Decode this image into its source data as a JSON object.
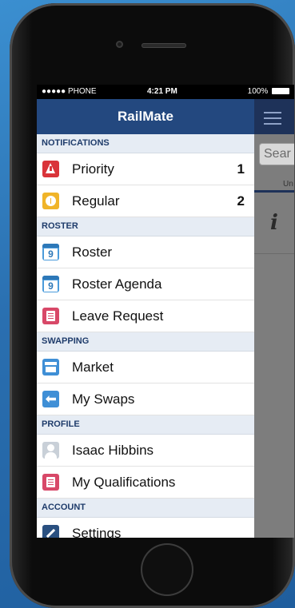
{
  "status_bar": {
    "carrier": "●●●●● PHONE",
    "time": "4:21 PM",
    "battery": "100%"
  },
  "app_title": "RailMate",
  "background_view": {
    "search_placeholder": "Sear",
    "tab_label": "Un"
  },
  "menu": {
    "notifications": {
      "header": "NOTIFICATIONS",
      "items": [
        {
          "label": "Priority",
          "count": "1",
          "icon": "alert-icon"
        },
        {
          "label": "Regular",
          "count": "2",
          "icon": "warning-icon"
        }
      ]
    },
    "roster": {
      "header": "ROSTER",
      "items": [
        {
          "label": "Roster",
          "icon": "calendar-icon",
          "icon_text": "9"
        },
        {
          "label": "Roster Agenda",
          "icon": "calendar-icon",
          "icon_text": "9"
        },
        {
          "label": "Leave Request",
          "icon": "document-icon"
        }
      ]
    },
    "swapping": {
      "header": "SWAPPING",
      "items": [
        {
          "label": "Market",
          "icon": "store-icon"
        },
        {
          "label": "My Swaps",
          "icon": "swap-icon"
        }
      ]
    },
    "profile": {
      "header": "PROFILE",
      "items": [
        {
          "label": "Isaac Hibbins",
          "icon": "avatar-icon"
        },
        {
          "label": "My Qualifications",
          "icon": "document-icon"
        }
      ]
    },
    "account": {
      "header": "ACCOUNT",
      "items": [
        {
          "label": "Settings",
          "icon": "settings-icon"
        }
      ]
    }
  },
  "colors": {
    "nav_bar": "#23487f",
    "section_header_bg": "#e6ecf4",
    "alert": "#d9343a",
    "warning": "#f0b429",
    "calendar": "#4a9bdb",
    "leave": "#d84868"
  }
}
